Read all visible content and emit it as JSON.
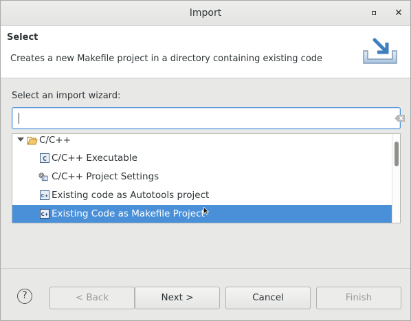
{
  "window": {
    "title": "Import"
  },
  "banner": {
    "heading": "Select",
    "description": "Creates a new Makefile project in a directory containing existing code"
  },
  "wizard": {
    "label": "Select an import wizard:",
    "filter_value": "",
    "tree": [
      {
        "label": "C/C++",
        "icon": "folder-open-icon",
        "expanded": true
      },
      {
        "label": "C/C++ Executable",
        "icon": "c-executable-icon"
      },
      {
        "label": "C/C++ Project Settings",
        "icon": "project-settings-icon"
      },
      {
        "label": "Existing code as Autotools project",
        "icon": "cpp-project-icon"
      },
      {
        "label": "Existing Code as Makefile Project",
        "icon": "cpp-project-icon",
        "selected": true
      }
    ]
  },
  "buttons": {
    "help": "?",
    "back": "< Back",
    "next": "Next >",
    "cancel": "Cancel",
    "finish": "Finish"
  },
  "colors": {
    "selection": "#4a90d9",
    "focus_border": "#4a90d9"
  }
}
